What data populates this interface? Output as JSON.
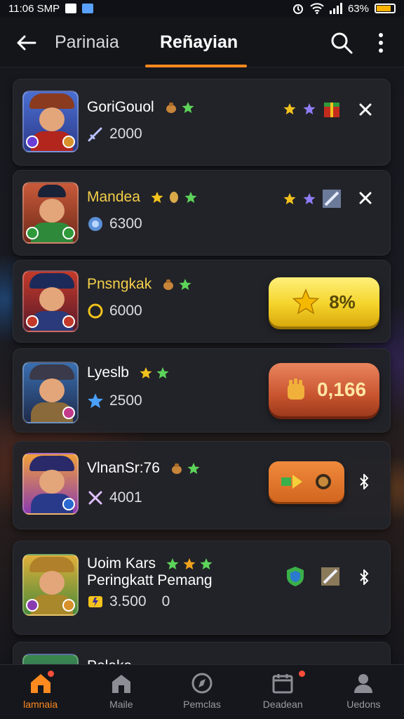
{
  "status_bar": {
    "time": "11:06 SMP",
    "battery_text": "63%"
  },
  "header": {
    "tabs": [
      {
        "label": "Parinaia",
        "active": false
      },
      {
        "label": "Reñayian",
        "active": true
      }
    ],
    "accent_color": "#ff8a1f"
  },
  "cards": [
    {
      "name": "GoriGouol",
      "value": "2000",
      "right": "stars-gift-close"
    },
    {
      "name": "Mandea",
      "value": "6300",
      "right": "stars-sword-close"
    },
    {
      "name": "Pnsngkak",
      "value": "6000",
      "button_text": "8%"
    },
    {
      "name": "Lyeslb",
      "value": "2500",
      "button_text": "0,166"
    },
    {
      "name": "VlnanSr:76",
      "value": "4001",
      "right": "orange-button-bluetooth"
    },
    {
      "name": "Uoim Kars",
      "name_line2": "Peringkatt Pemang",
      "value": "3.500",
      "value_suffix": "0"
    }
  ],
  "partial_card": {
    "name": "Pelaka"
  },
  "bottom_nav": [
    {
      "label": "lamnaia",
      "active": true,
      "icon": "home-icon"
    },
    {
      "label": "Maile",
      "active": false,
      "icon": "house-icon"
    },
    {
      "label": "Pemclas",
      "active": false,
      "icon": "compass-icon"
    },
    {
      "label": "Deadean",
      "active": false,
      "icon": "calendar-icon"
    },
    {
      "label": "Uedons",
      "active": false,
      "icon": "person-icon"
    }
  ]
}
